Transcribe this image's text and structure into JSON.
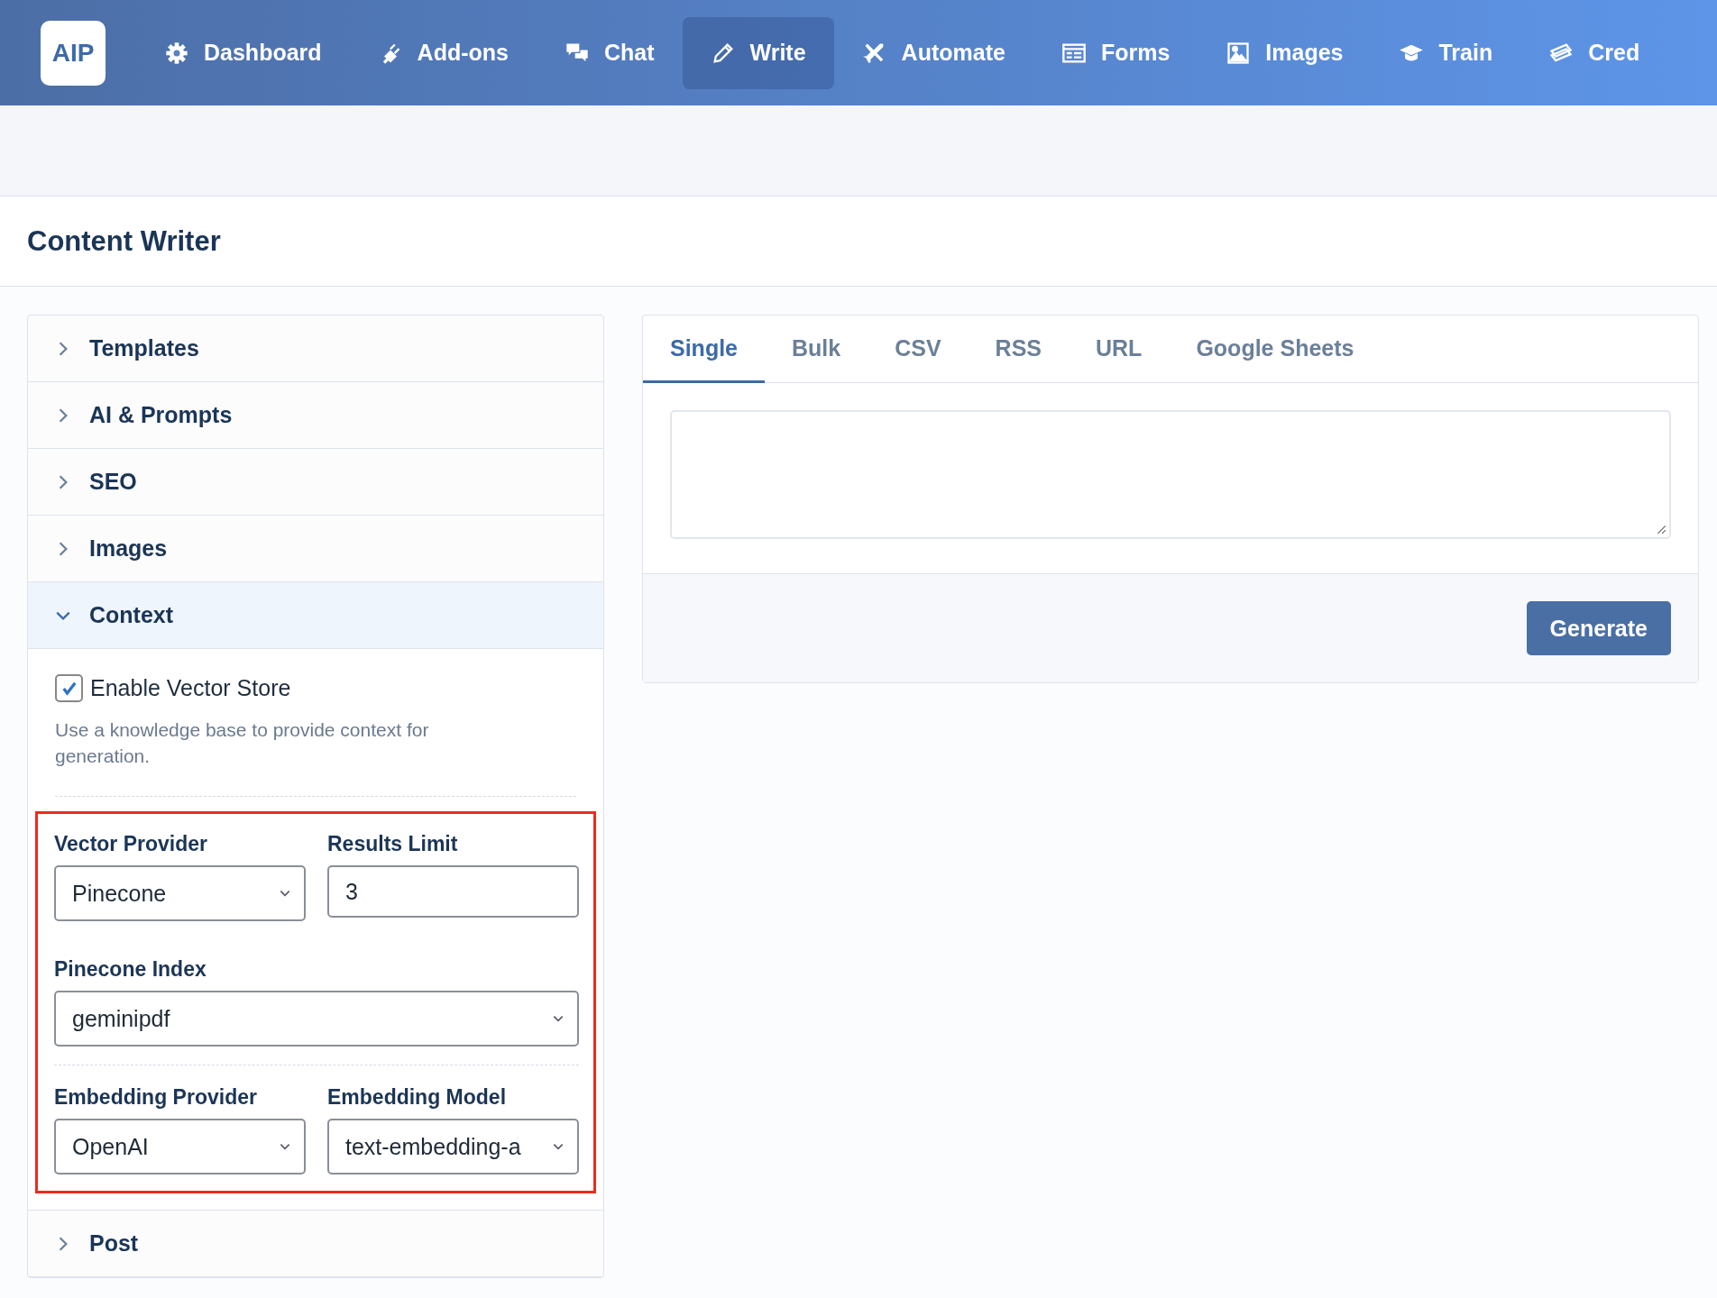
{
  "nav": {
    "logo": "AIP",
    "items": [
      {
        "label": "Dashboard",
        "selected": false
      },
      {
        "label": "Add-ons",
        "selected": false
      },
      {
        "label": "Chat",
        "selected": false
      },
      {
        "label": "Write",
        "selected": true
      },
      {
        "label": "Automate",
        "selected": false
      },
      {
        "label": "Forms",
        "selected": false
      },
      {
        "label": "Images",
        "selected": false
      },
      {
        "label": "Train",
        "selected": false
      },
      {
        "label": "Cred",
        "selected": false
      }
    ]
  },
  "page_title": "Content Writer",
  "sections": [
    {
      "title": "Templates",
      "expanded": false
    },
    {
      "title": "AI & Prompts",
      "expanded": false
    },
    {
      "title": "SEO",
      "expanded": false
    },
    {
      "title": "Images",
      "expanded": false
    },
    {
      "title": "Context",
      "expanded": true
    },
    {
      "title": "Post",
      "expanded": false
    }
  ],
  "context": {
    "checkbox": {
      "label": "Enable Vector Store",
      "checked": true
    },
    "description": "Use a knowledge base to provide context for generation.",
    "fields": [
      {
        "label": "Vector Provider",
        "value": "Pinecone",
        "kind": "select",
        "wide": false
      },
      {
        "label": "Results Limit",
        "value": "3",
        "kind": "input",
        "wide": false
      },
      {
        "label": "Pinecone Index",
        "value": "geminipdf",
        "kind": "select",
        "wide": true
      },
      {
        "label": "Embedding Provider",
        "value": "OpenAI",
        "kind": "select",
        "wide": false
      },
      {
        "label": "Embedding Model",
        "value": "text-embedding-a",
        "kind": "select",
        "wide": false
      }
    ]
  },
  "tabs": [
    {
      "label": "Single",
      "selected": true
    },
    {
      "label": "Bulk",
      "selected": false
    },
    {
      "label": "CSV",
      "selected": false
    },
    {
      "label": "RSS",
      "selected": false
    },
    {
      "label": "URL",
      "selected": false
    },
    {
      "label": "Google Sheets",
      "selected": false
    }
  ],
  "generate_button": "Generate"
}
